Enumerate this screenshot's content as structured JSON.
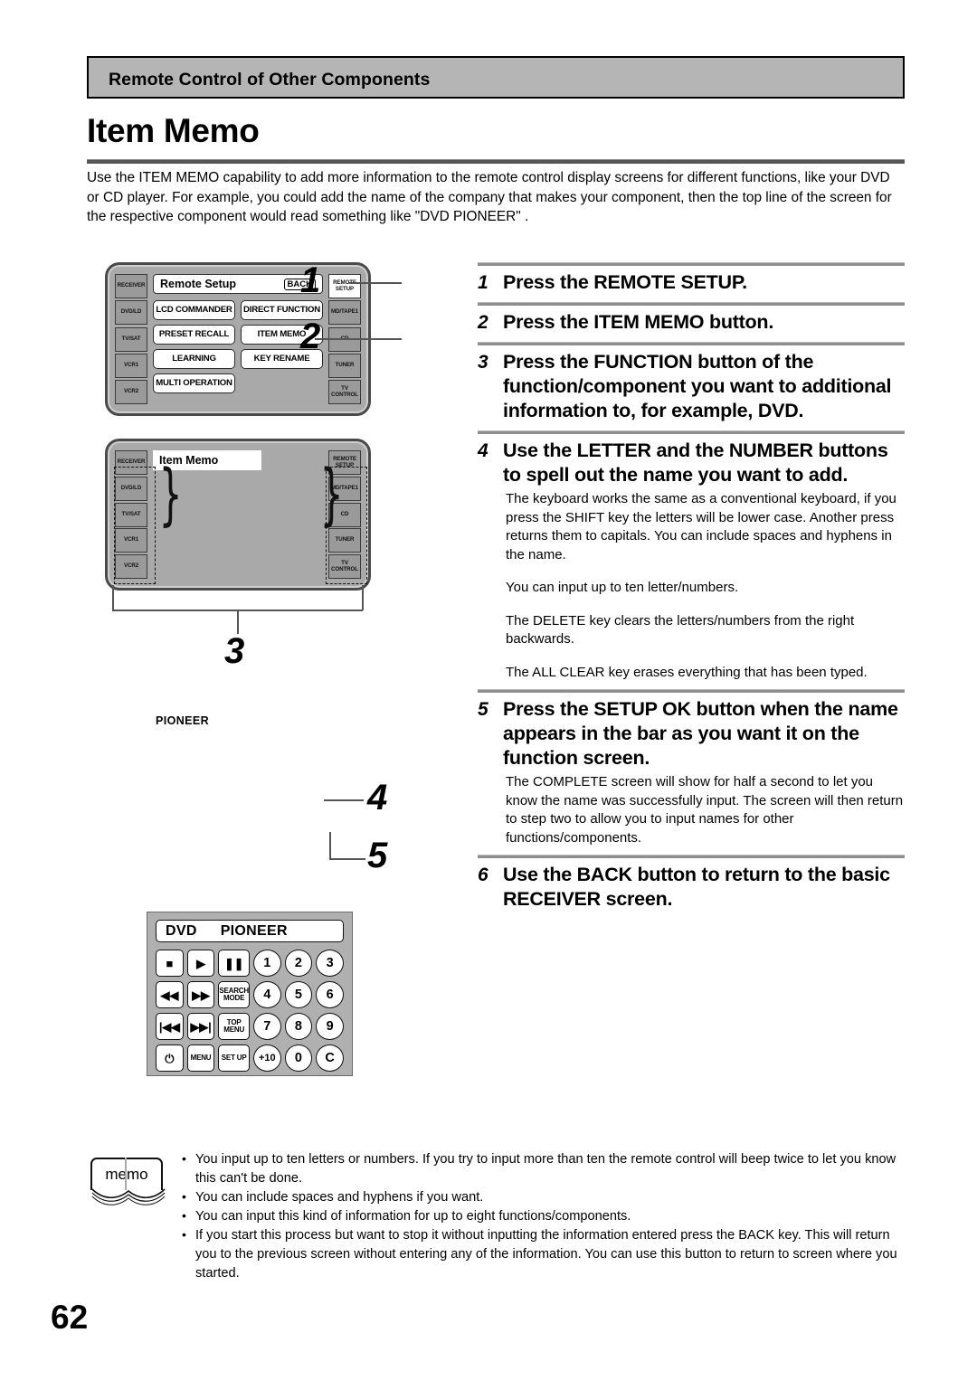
{
  "page": {
    "section_header": "Remote Control of Other Components",
    "title": "Item Memo",
    "page_number": "62",
    "intro": "Use the ITEM MEMO capability to add more information to the remote control display screens for different functions, like your DVD or CD player. For example, you could add the name of the company that makes your component, then the top line of the screen for the respective component would read something like \"DVD PIONEER\" ."
  },
  "colors": {
    "header_gray": "#b5b5b5",
    "rule_gray": "#8e8e8e",
    "remote_body": "#a9a9a9",
    "key_gray": "#9a9a9a"
  },
  "illustrations": {
    "remote_setup_screen": {
      "screen_title": "Remote Setup",
      "back_label": "BACK",
      "left_keys": [
        "RECEIVER",
        "DVD/LD",
        "TV/SAT",
        "VCR1",
        "VCR2"
      ],
      "right_keys": [
        "REMOTE SETUP",
        "MD/TAPE1",
        "CD",
        "TUNER",
        "TV CONTROL"
      ],
      "menu_buttons": [
        "LCD COMMANDER",
        "DIRECT FUNCTION",
        "PRESET RECALL",
        "ITEM MEMO",
        "LEARNING",
        "KEY RENAME",
        "MULTI OPERATION"
      ]
    },
    "item_memo_screen": {
      "screen_title": "Item Memo",
      "left_keys": [
        "RECEIVER",
        "DVD/LD",
        "TV/SAT",
        "VCR1",
        "VCR2"
      ],
      "right_keys": [
        "REMOTE SETUP",
        "MD/TAPE1",
        "CD",
        "TUNER",
        "TV CONTROL"
      ]
    },
    "pioneer_caption": "PIONEER",
    "dvd_remote": {
      "display_left": "DVD",
      "display_right": "PIONEER",
      "keys": [
        "■",
        "▶",
        "❚❚",
        "1",
        "2",
        "3",
        "◀◀",
        "▶▶",
        "SEARCH MODE",
        "4",
        "5",
        "6",
        "|◀◀",
        "▶▶|",
        "TOP MENU",
        "7",
        "8",
        "9",
        "⏻",
        "MENU",
        "SET UP",
        "+10",
        "0",
        "C"
      ]
    },
    "callouts": [
      "1",
      "2",
      "3",
      "4",
      "5"
    ]
  },
  "steps": [
    {
      "num": "1",
      "heading": "Press the REMOTE SETUP.",
      "body": []
    },
    {
      "num": "2",
      "heading": "Press the ITEM MEMO button.",
      "body": []
    },
    {
      "num": "3",
      "heading": "Press the FUNCTION button of the function/component you want to additional information to, for example, DVD.",
      "body": []
    },
    {
      "num": "4",
      "heading": "Use the LETTER and the NUMBER buttons to spell out the name you want to add.",
      "body": [
        "The keyboard works the same as a conventional keyboard, if you press the SHIFT key the letters will be lower case. Another press returns them to capitals. You can include spaces and hyphens in the name.",
        "You can input up to ten letter/numbers.",
        "The DELETE key clears the letters/numbers from the right backwards.",
        "The ALL CLEAR key erases everything that has been typed."
      ]
    },
    {
      "num": "5",
      "heading": "Press the SETUP OK button when the name appears in the bar as you want it on the function screen.",
      "body": [
        "The COMPLETE screen will show for half a second to let you know the name was successfully input. The screen will then return to step two to allow you to input names for other functions/components."
      ]
    },
    {
      "num": "6",
      "heading": "Use the BACK button to return to the basic RECEIVER screen.",
      "body": []
    }
  ],
  "memo": {
    "label": "memo",
    "items": [
      "You input up to ten letters or numbers. If you try to input more than ten the remote control will beep twice to let you know this can't be done.",
      "You can include spaces and hyphens if you want.",
      "You can input this kind of information for up to eight functions/components.",
      "If you start this process but want to stop it without inputting the information entered press the BACK key. This will return you to the previous screen without entering any of the information. You can use this button to return to screen where you started."
    ]
  }
}
